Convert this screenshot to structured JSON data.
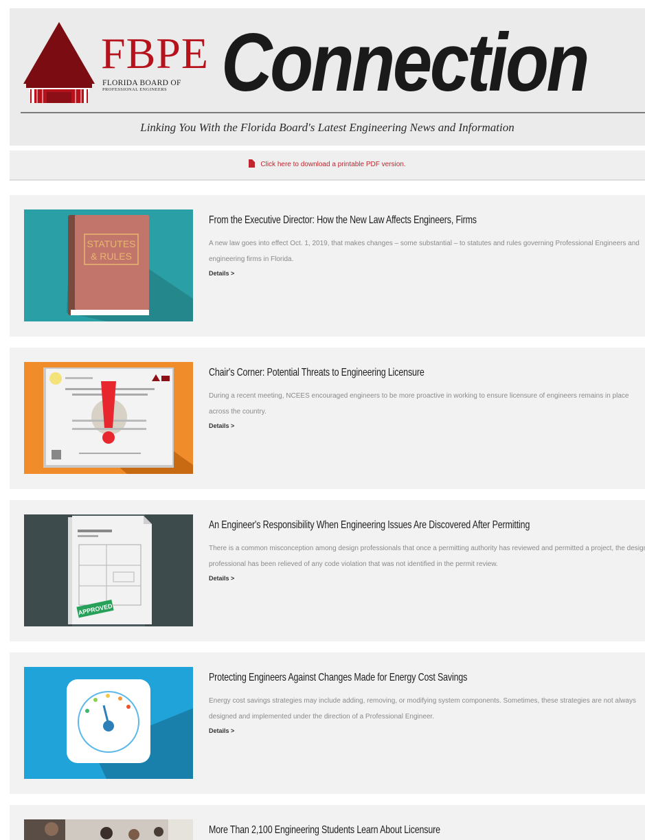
{
  "header": {
    "org_abbrev": "FBPE",
    "org_name_line1": "FLORIDA BOARD OF",
    "org_name_line2": "PROFESSIONAL ENGINEERS",
    "newsletter_title": "Connection",
    "tagline": "Linking You With the Florida Board's Latest Engineering News and Information",
    "colors": {
      "brand_red": "#b5121b",
      "brand_dark_red": "#7a0c12"
    }
  },
  "pdf_bar": {
    "icon": "pdf-file-icon",
    "link_text": "Click here to download a printable PDF version."
  },
  "articles": [
    {
      "title": "From the Executive Director: How the New Law Affects Engineers, Firms",
      "description": "A new law goes into effect Oct. 1, 2019, that makes changes – some substantial – to statutes and rules governing Professional Engineers and engineering firms in Florida.",
      "details_label": "Details >",
      "thumb_text_line1": "STATUTES",
      "thumb_text_line2": "& RULES",
      "thumb_icon": "law-book-icon"
    },
    {
      "title": "Chair's Corner: Potential Threats to Engineering Licensure",
      "description": "During a recent meeting, NCEES encouraged engineers to be more proactive in working to ensure licensure of engineers remains in place across the country.",
      "details_label": "Details >",
      "thumb_icon": "license-warning-icon"
    },
    {
      "title": "An Engineer's Responsibility When Engineering Issues Are Discovered After Permitting",
      "description": "There is a common misconception among design professionals that once a permitting authority has reviewed and permitted a project, the design professional has been relieved of any code violation that was not identified in the permit review.",
      "details_label": "Details >",
      "thumb_text_line1": "APPROVED",
      "thumb_icon": "approved-blueprint-icon"
    },
    {
      "title": "Protecting Engineers Against Changes Made for Energy Cost Savings",
      "description": "Energy cost savings strategies may include adding, removing, or modifying system components. Sometimes, these strategies are not always designed and implemented under the direction of a Professional Engineer.",
      "details_label": "Details >",
      "thumb_icon": "gauge-icon"
    },
    {
      "title": "More Than 2,100 Engineering Students Learn About Licensure",
      "description": "",
      "details_label": "",
      "thumb_icon": "students-photo"
    }
  ]
}
